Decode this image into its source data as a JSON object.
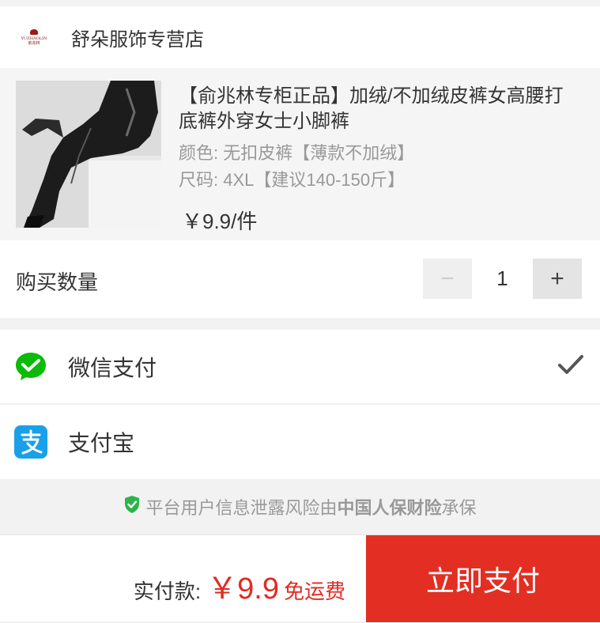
{
  "shop": {
    "logo_text": "YUZHAOLIN",
    "logo_text_cn": "俞兆林",
    "name": "舒朵服饰专营店"
  },
  "product": {
    "title": "【俞兆林专柜正品】加绒/不加绒皮裤女高腰打底裤外穿女士小脚裤",
    "color": "颜色: 无扣皮裤【薄款不加绒】",
    "size": "尺码: 4XL【建议140-150斤】",
    "price": "￥9.9/件"
  },
  "quantity": {
    "label": "购买数量",
    "value": "1",
    "minus": "−",
    "plus": "+"
  },
  "payment": {
    "methods": [
      {
        "label": "微信支付",
        "icon": "wechat-pay-icon",
        "selected": true
      },
      {
        "label": "支付宝",
        "icon": "alipay-icon",
        "selected": false
      }
    ]
  },
  "insurance": {
    "text_before": "平台用户信息泄露风险由",
    "brand": "中国人保财险",
    "text_after": "承保"
  },
  "footer": {
    "total_label": "实付款:",
    "total_amount": "￥9.9",
    "shipping": "免运费",
    "pay_button": "立即支付"
  },
  "colors": {
    "accent": "#e32e23",
    "wechat": "#09bb07",
    "alipay": "#1aa0e8"
  }
}
